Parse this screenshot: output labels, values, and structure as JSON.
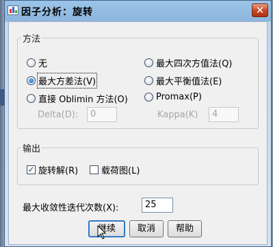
{
  "dialog": {
    "title": "因子分析：旋转",
    "close_glyph": "✕"
  },
  "method": {
    "legend": "方法",
    "options": [
      {
        "label": "无",
        "selected": false
      },
      {
        "label": "最大方差法(V)",
        "selected": true
      },
      {
        "label": "直接 Oblimin 方法(O)",
        "selected": false
      },
      {
        "label": "最大四次方值法(Q)",
        "selected": false
      },
      {
        "label": "最大平衡值法(E)",
        "selected": false
      },
      {
        "label": "Promax(P)",
        "selected": false
      }
    ],
    "delta_label": "Delta(D):",
    "delta_value": "0",
    "kappa_label": "Kappa(K)",
    "kappa_value": "4"
  },
  "output": {
    "legend": "输出",
    "rotated_solution_label": "旋转解(R)",
    "rotated_solution_checked": true,
    "loading_plot_label": "载荷图(L)",
    "loading_plot_checked": false
  },
  "max_iterations": {
    "label": "最大收敛性迭代次数(X):",
    "value": "25"
  },
  "buttons": {
    "continue": "继续",
    "cancel": "取消",
    "help": "帮助"
  },
  "icons": {
    "title_icon": "spss-chart-icon",
    "close_icon": "close-icon",
    "check_glyph": "✓",
    "cursor": "mouse-pointer-icon"
  },
  "colors": {
    "close_button": "#c8462a",
    "default_button_border": "#2f79c8",
    "radio_selected": "#0a56b8"
  }
}
